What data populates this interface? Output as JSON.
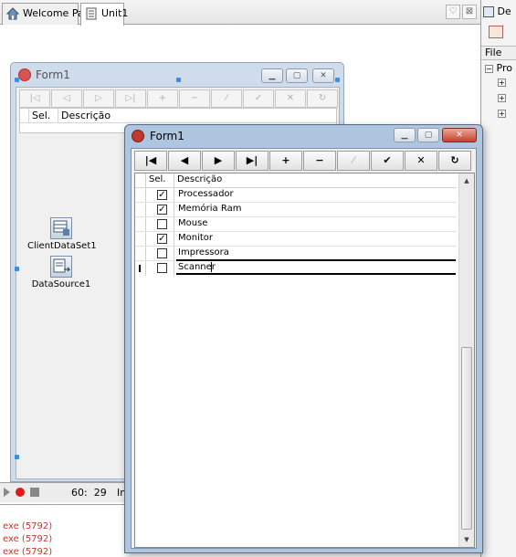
{
  "tabs": [
    {
      "label": "Welcome Page",
      "icon": "house-icon"
    },
    {
      "label": "Unit1",
      "icon": "unit-icon"
    }
  ],
  "right_panel": {
    "title_fragment": "De",
    "file_label": "File",
    "proj_fragment": "Pro"
  },
  "status": {
    "position": "60:  29",
    "mode_fragment": "In"
  },
  "messages": [
    "exe (5792)",
    "exe (5792)",
    "exe (5792)"
  ],
  "design_form": {
    "title": "Form1",
    "grid_headers": [
      "Sel.",
      "Descrição"
    ],
    "components": [
      {
        "label": "ClientDataSet1",
        "icon": "clientdataset-icon"
      },
      {
        "label": "DataSource1",
        "icon": "datasource-icon"
      }
    ]
  },
  "runtime_form": {
    "title": "Form1",
    "navigator": [
      {
        "glyph": "|◀",
        "name": "first"
      },
      {
        "glyph": "◀",
        "name": "prior"
      },
      {
        "glyph": "▶",
        "name": "next"
      },
      {
        "glyph": "▶|",
        "name": "last"
      },
      {
        "glyph": "+",
        "name": "insert"
      },
      {
        "glyph": "−",
        "name": "delete"
      },
      {
        "glyph": "⁄",
        "name": "edit",
        "disabled": true
      },
      {
        "glyph": "✔",
        "name": "post"
      },
      {
        "glyph": "✕",
        "name": "cancel"
      },
      {
        "glyph": "↻",
        "name": "refresh"
      }
    ],
    "grid_headers": [
      "Sel.",
      "Descrição"
    ],
    "rows": [
      {
        "sel": true,
        "desc": "Processador"
      },
      {
        "sel": true,
        "desc": "Memória Ram"
      },
      {
        "sel": false,
        "desc": "Mouse"
      },
      {
        "sel": true,
        "desc": "Monitor"
      },
      {
        "sel": false,
        "desc": "Impressora"
      },
      {
        "sel": false,
        "desc": "Scanner",
        "current": true
      }
    ]
  }
}
